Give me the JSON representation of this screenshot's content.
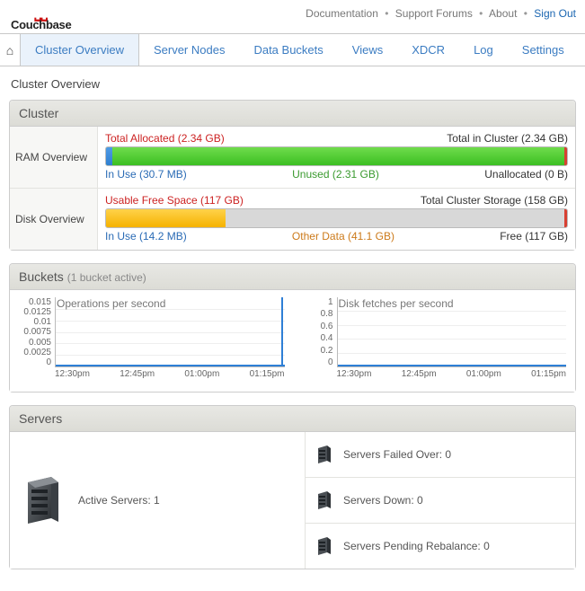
{
  "brand": {
    "name": "Couchbase"
  },
  "top_links": {
    "documentation": "Documentation",
    "support": "Support Forums",
    "about": "About",
    "signout": "Sign Out"
  },
  "nav": {
    "cluster_overview": "Cluster Overview",
    "server_nodes": "Server Nodes",
    "data_buckets": "Data Buckets",
    "views": "Views",
    "xdcr": "XDCR",
    "log": "Log",
    "settings": "Settings"
  },
  "page": {
    "title": "Cluster Overview"
  },
  "cluster_panel": {
    "header": "Cluster",
    "ram": {
      "label": "RAM Overview",
      "top": {
        "left": "Total Allocated (2.34 GB)",
        "right": "Total in Cluster (2.34 GB)"
      },
      "bottom": {
        "left": "In Use (30.7 MB)",
        "mid": "Unused (2.31 GB)",
        "right": "Unallocated (0 B)"
      },
      "bar": {
        "green_pct": 100,
        "blue_pct": 1.3
      }
    },
    "disk": {
      "label": "Disk Overview",
      "top": {
        "left": "Usable Free Space (117 GB)",
        "right": "Total Cluster Storage (158 GB)"
      },
      "bottom": {
        "left": "In Use (14.2 MB)",
        "mid": "Other Data (41.1 GB)",
        "right": "Free (117 GB)"
      },
      "bar": {
        "yellow_pct": 26,
        "blue_pct": 0.01
      }
    }
  },
  "buckets_panel": {
    "header": "Buckets",
    "sub": "(1 bucket active)",
    "ops": {
      "title": "Operations per second",
      "y": [
        "0.015",
        "0.0125",
        "0.01",
        "0.0075",
        "0.005",
        "0.0025",
        "0"
      ],
      "x": [
        "12:30pm",
        "12:45pm",
        "01:00pm",
        "01:15pm"
      ]
    },
    "fetch": {
      "title": "Disk fetches per second",
      "y": [
        "1",
        "0.8",
        "0.6",
        "0.4",
        "0.2",
        "0"
      ],
      "x": [
        "12:30pm",
        "12:45pm",
        "01:00pm",
        "01:15pm"
      ]
    }
  },
  "chart_data": [
    {
      "type": "line",
      "title": "Operations per second",
      "xlabel": "",
      "ylabel": "",
      "ylim": [
        0,
        0.015
      ],
      "x_ticks": [
        "12:30pm",
        "12:45pm",
        "01:00pm",
        "01:15pm"
      ],
      "series": [
        {
          "name": "ops",
          "x": [
            "12:30pm",
            "12:45pm",
            "01:00pm",
            "01:15pm",
            "~01:28pm"
          ],
          "values": [
            0,
            0,
            0,
            0,
            0.015
          ]
        }
      ]
    },
    {
      "type": "line",
      "title": "Disk fetches per second",
      "xlabel": "",
      "ylabel": "",
      "ylim": [
        0,
        1
      ],
      "x_ticks": [
        "12:30pm",
        "12:45pm",
        "01:00pm",
        "01:15pm"
      ],
      "series": [
        {
          "name": "fetches",
          "x": [
            "12:30pm",
            "12:45pm",
            "01:00pm",
            "01:15pm"
          ],
          "values": [
            0,
            0,
            0,
            0
          ]
        }
      ]
    }
  ],
  "servers_panel": {
    "header": "Servers",
    "active": "Active Servers: 1",
    "failed": "Servers Failed Over: 0",
    "down": "Servers Down: 0",
    "rebalance": "Servers Pending Rebalance: 0"
  }
}
